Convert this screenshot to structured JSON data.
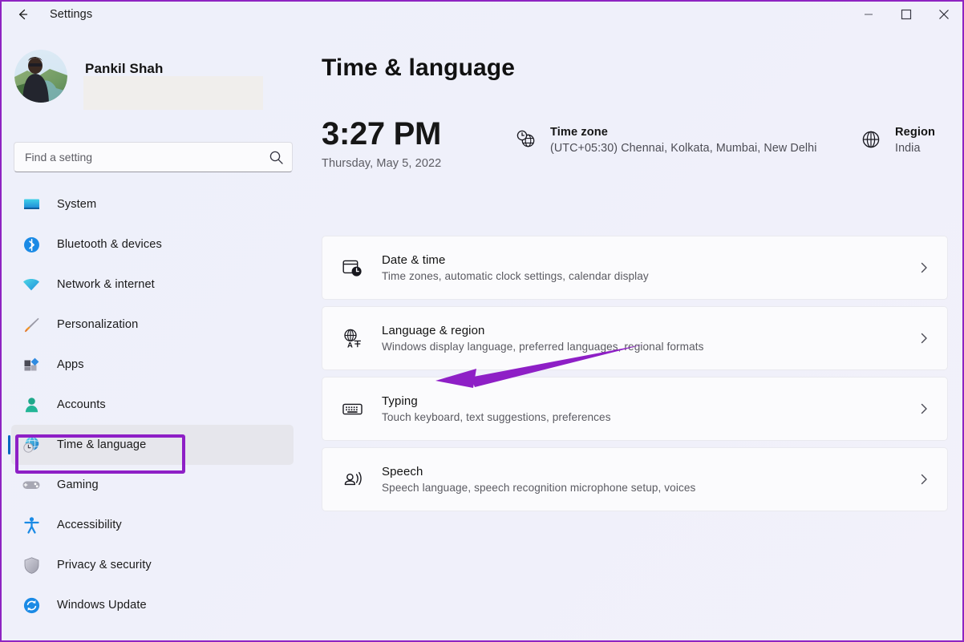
{
  "window": {
    "title": "Settings",
    "back_icon": "back-arrow-icon",
    "controls": [
      {
        "name": "minimize",
        "label": "—"
      },
      {
        "name": "maximize",
        "label": "□"
      },
      {
        "name": "close",
        "label": "✕"
      }
    ]
  },
  "account": {
    "name": "Pankil Shah",
    "email_redacted": true
  },
  "search": {
    "placeholder": "Find a setting",
    "value": "",
    "icon": "search-icon"
  },
  "sidebar": {
    "items": [
      {
        "label": "System",
        "icon": "monitor-icon",
        "selected": false
      },
      {
        "label": "Bluetooth & devices",
        "icon": "bluetooth-icon",
        "selected": false
      },
      {
        "label": "Network & internet",
        "icon": "wifi-icon",
        "selected": false
      },
      {
        "label": "Personalization",
        "icon": "paintbrush-icon",
        "selected": false
      },
      {
        "label": "Apps",
        "icon": "apps-icon",
        "selected": false
      },
      {
        "label": "Accounts",
        "icon": "person-icon",
        "selected": false
      },
      {
        "label": "Time & language",
        "icon": "clock-globe-icon",
        "selected": true
      },
      {
        "label": "Gaming",
        "icon": "gamepad-icon",
        "selected": false
      },
      {
        "label": "Accessibility",
        "icon": "accessibility-icon",
        "selected": false
      },
      {
        "label": "Privacy & security",
        "icon": "shield-icon",
        "selected": false
      },
      {
        "label": "Windows Update",
        "icon": "update-icon",
        "selected": false
      }
    ]
  },
  "page": {
    "title": "Time & language",
    "clock": {
      "time": "3:27 PM",
      "date": "Thursday, May 5, 2022"
    },
    "time_zone": {
      "icon": "clock-globe-icon",
      "title": "Time zone",
      "value": "(UTC+05:30) Chennai, Kolkata, Mumbai, New Delhi"
    },
    "region": {
      "icon": "globe-icon",
      "title": "Region",
      "value": "India"
    },
    "cards": [
      {
        "icon": "date-time-icon",
        "title": "Date & time",
        "subtitle": "Time zones, automatic clock settings, calendar display",
        "chevron": "chevron-right-icon"
      },
      {
        "icon": "language-icon",
        "title": "Language & region",
        "subtitle": "Windows display language, preferred languages, regional formats",
        "chevron": "chevron-right-icon"
      },
      {
        "icon": "keyboard-icon",
        "title": "Typing",
        "subtitle": "Touch keyboard, text suggestions, preferences",
        "chevron": "chevron-right-icon"
      },
      {
        "icon": "speech-icon",
        "title": "Speech",
        "subtitle": "Speech language, speech recognition microphone setup, voices",
        "chevron": "chevron-right-icon"
      }
    ]
  },
  "annotations": {
    "highlight_color": "#8e1fc6",
    "highlight_target": "Time & language",
    "arrow_color": "#8e1fc6",
    "arrow_target": "Typing"
  },
  "colors": {
    "background": "#eff0fa",
    "card": "#fbfbfd",
    "accent": "#0067c0",
    "annotation": "#8e1fc6"
  }
}
